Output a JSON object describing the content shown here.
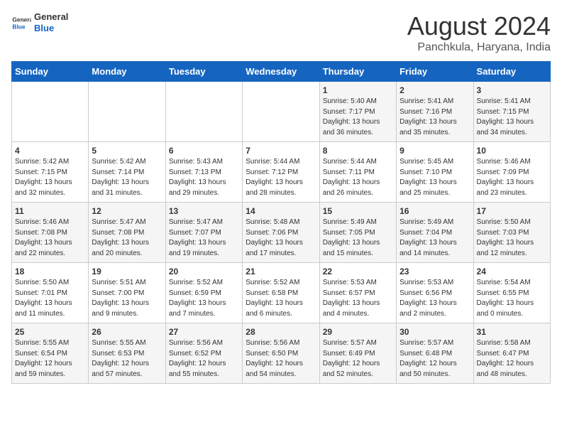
{
  "logo": {
    "text_general": "General",
    "text_blue": "Blue"
  },
  "header": {
    "title": "August 2024",
    "subtitle": "Panchkula, Haryana, India"
  },
  "weekdays": [
    "Sunday",
    "Monday",
    "Tuesday",
    "Wednesday",
    "Thursday",
    "Friday",
    "Saturday"
  ],
  "weeks": [
    [
      {
        "day": "",
        "info": ""
      },
      {
        "day": "",
        "info": ""
      },
      {
        "day": "",
        "info": ""
      },
      {
        "day": "",
        "info": ""
      },
      {
        "day": "1",
        "info": "Sunrise: 5:40 AM\nSunset: 7:17 PM\nDaylight: 13 hours\nand 36 minutes."
      },
      {
        "day": "2",
        "info": "Sunrise: 5:41 AM\nSunset: 7:16 PM\nDaylight: 13 hours\nand 35 minutes."
      },
      {
        "day": "3",
        "info": "Sunrise: 5:41 AM\nSunset: 7:15 PM\nDaylight: 13 hours\nand 34 minutes."
      }
    ],
    [
      {
        "day": "4",
        "info": "Sunrise: 5:42 AM\nSunset: 7:15 PM\nDaylight: 13 hours\nand 32 minutes."
      },
      {
        "day": "5",
        "info": "Sunrise: 5:42 AM\nSunset: 7:14 PM\nDaylight: 13 hours\nand 31 minutes."
      },
      {
        "day": "6",
        "info": "Sunrise: 5:43 AM\nSunset: 7:13 PM\nDaylight: 13 hours\nand 29 minutes."
      },
      {
        "day": "7",
        "info": "Sunrise: 5:44 AM\nSunset: 7:12 PM\nDaylight: 13 hours\nand 28 minutes."
      },
      {
        "day": "8",
        "info": "Sunrise: 5:44 AM\nSunset: 7:11 PM\nDaylight: 13 hours\nand 26 minutes."
      },
      {
        "day": "9",
        "info": "Sunrise: 5:45 AM\nSunset: 7:10 PM\nDaylight: 13 hours\nand 25 minutes."
      },
      {
        "day": "10",
        "info": "Sunrise: 5:46 AM\nSunset: 7:09 PM\nDaylight: 13 hours\nand 23 minutes."
      }
    ],
    [
      {
        "day": "11",
        "info": "Sunrise: 5:46 AM\nSunset: 7:08 PM\nDaylight: 13 hours\nand 22 minutes."
      },
      {
        "day": "12",
        "info": "Sunrise: 5:47 AM\nSunset: 7:08 PM\nDaylight: 13 hours\nand 20 minutes."
      },
      {
        "day": "13",
        "info": "Sunrise: 5:47 AM\nSunset: 7:07 PM\nDaylight: 13 hours\nand 19 minutes."
      },
      {
        "day": "14",
        "info": "Sunrise: 5:48 AM\nSunset: 7:06 PM\nDaylight: 13 hours\nand 17 minutes."
      },
      {
        "day": "15",
        "info": "Sunrise: 5:49 AM\nSunset: 7:05 PM\nDaylight: 13 hours\nand 15 minutes."
      },
      {
        "day": "16",
        "info": "Sunrise: 5:49 AM\nSunset: 7:04 PM\nDaylight: 13 hours\nand 14 minutes."
      },
      {
        "day": "17",
        "info": "Sunrise: 5:50 AM\nSunset: 7:03 PM\nDaylight: 13 hours\nand 12 minutes."
      }
    ],
    [
      {
        "day": "18",
        "info": "Sunrise: 5:50 AM\nSunset: 7:01 PM\nDaylight: 13 hours\nand 11 minutes."
      },
      {
        "day": "19",
        "info": "Sunrise: 5:51 AM\nSunset: 7:00 PM\nDaylight: 13 hours\nand 9 minutes."
      },
      {
        "day": "20",
        "info": "Sunrise: 5:52 AM\nSunset: 6:59 PM\nDaylight: 13 hours\nand 7 minutes."
      },
      {
        "day": "21",
        "info": "Sunrise: 5:52 AM\nSunset: 6:58 PM\nDaylight: 13 hours\nand 6 minutes."
      },
      {
        "day": "22",
        "info": "Sunrise: 5:53 AM\nSunset: 6:57 PM\nDaylight: 13 hours\nand 4 minutes."
      },
      {
        "day": "23",
        "info": "Sunrise: 5:53 AM\nSunset: 6:56 PM\nDaylight: 13 hours\nand 2 minutes."
      },
      {
        "day": "24",
        "info": "Sunrise: 5:54 AM\nSunset: 6:55 PM\nDaylight: 13 hours\nand 0 minutes."
      }
    ],
    [
      {
        "day": "25",
        "info": "Sunrise: 5:55 AM\nSunset: 6:54 PM\nDaylight: 12 hours\nand 59 minutes."
      },
      {
        "day": "26",
        "info": "Sunrise: 5:55 AM\nSunset: 6:53 PM\nDaylight: 12 hours\nand 57 minutes."
      },
      {
        "day": "27",
        "info": "Sunrise: 5:56 AM\nSunset: 6:52 PM\nDaylight: 12 hours\nand 55 minutes."
      },
      {
        "day": "28",
        "info": "Sunrise: 5:56 AM\nSunset: 6:50 PM\nDaylight: 12 hours\nand 54 minutes."
      },
      {
        "day": "29",
        "info": "Sunrise: 5:57 AM\nSunset: 6:49 PM\nDaylight: 12 hours\nand 52 minutes."
      },
      {
        "day": "30",
        "info": "Sunrise: 5:57 AM\nSunset: 6:48 PM\nDaylight: 12 hours\nand 50 minutes."
      },
      {
        "day": "31",
        "info": "Sunrise: 5:58 AM\nSunset: 6:47 PM\nDaylight: 12 hours\nand 48 minutes."
      }
    ]
  ]
}
